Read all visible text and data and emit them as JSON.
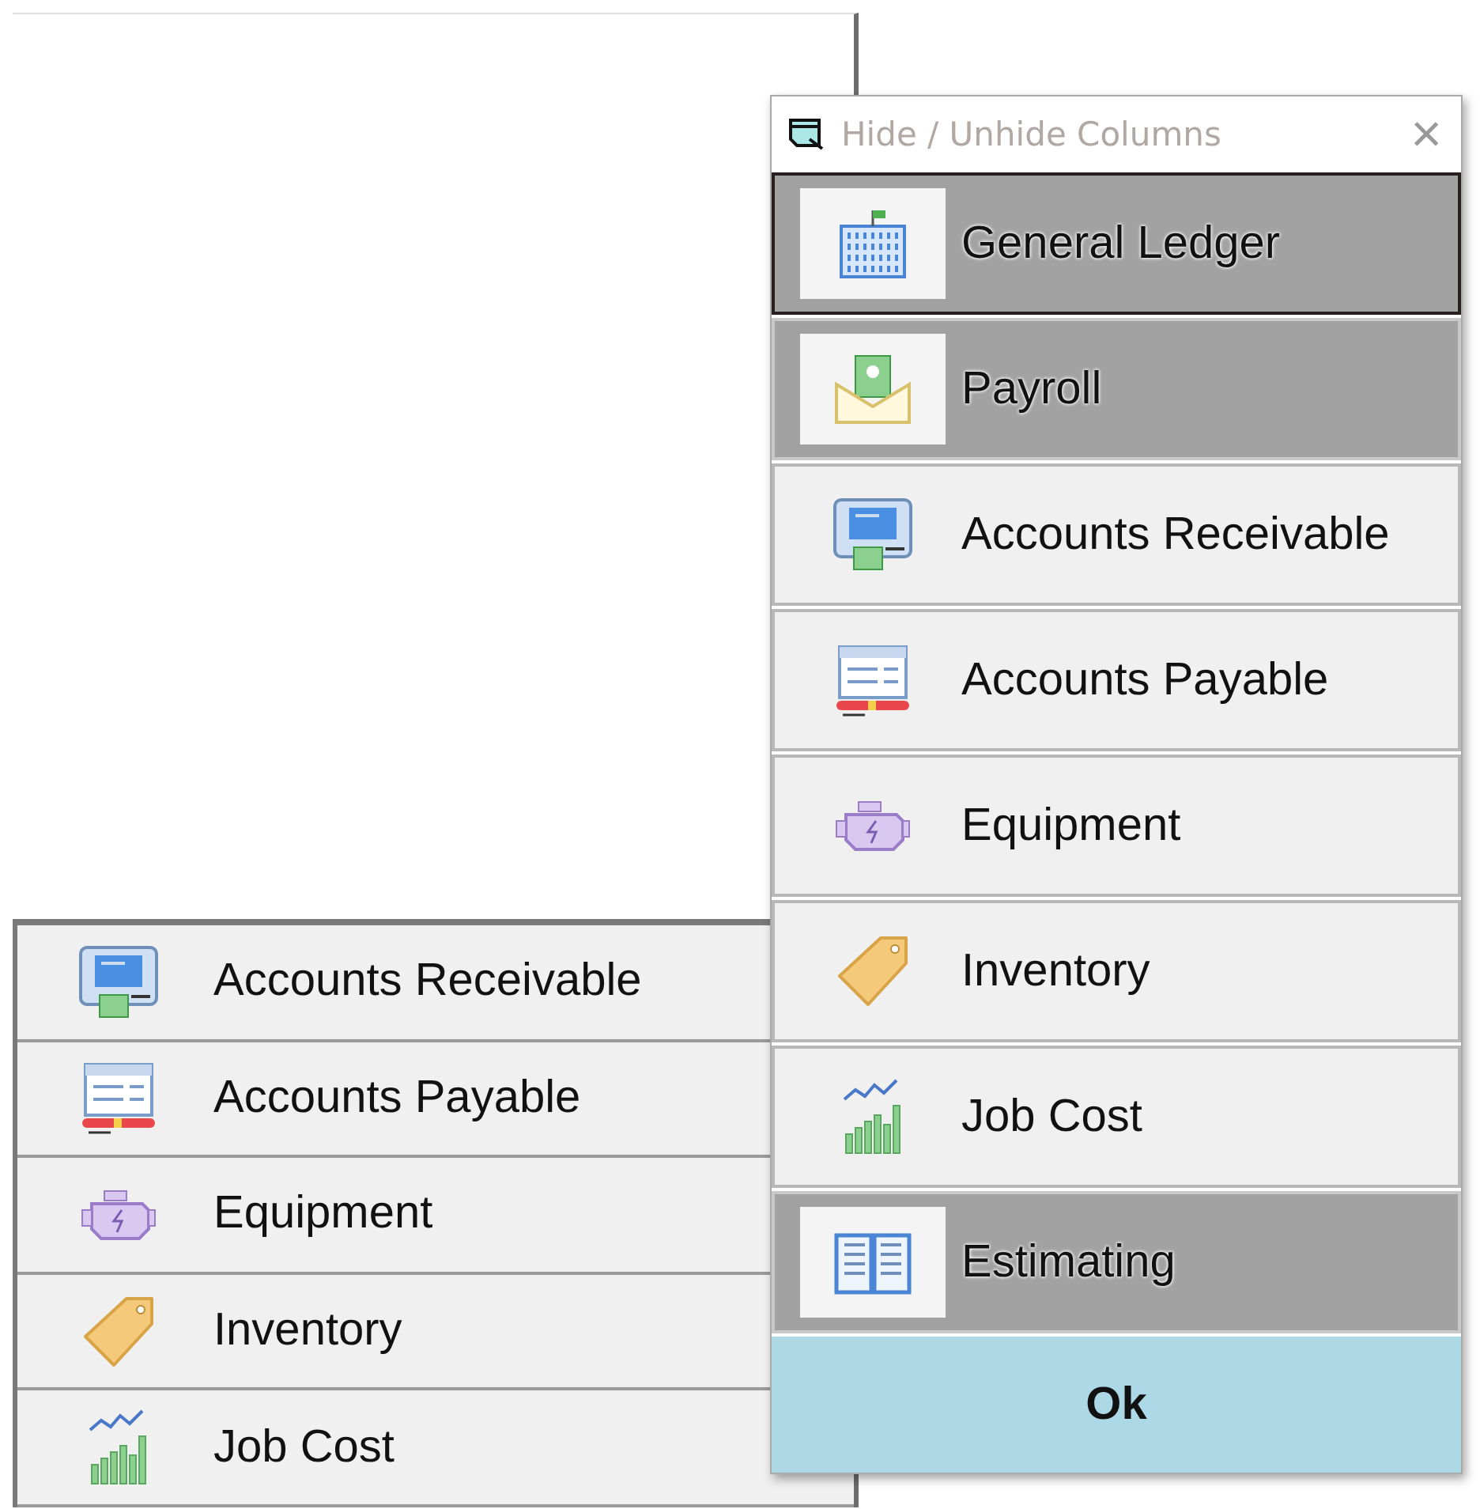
{
  "visible_columns": [
    {
      "label": "Accounts Receivable"
    },
    {
      "label": "Accounts Payable"
    },
    {
      "label": "Equipment"
    },
    {
      "label": "Inventory"
    },
    {
      "label": "Job Cost"
    }
  ],
  "dialog": {
    "title": "Hide / Unhide Columns",
    "close": "×",
    "items": [
      {
        "label": "General Ledger",
        "hidden": true,
        "focused": true
      },
      {
        "label": "Payroll",
        "hidden": true,
        "focused": false
      },
      {
        "label": "Accounts Receivable",
        "hidden": false,
        "focused": false
      },
      {
        "label": "Accounts Payable",
        "hidden": false,
        "focused": false
      },
      {
        "label": "Equipment",
        "hidden": false,
        "focused": false
      },
      {
        "label": "Inventory",
        "hidden": false,
        "focused": false
      },
      {
        "label": "Job Cost",
        "hidden": false,
        "focused": false
      },
      {
        "label": "Estimating",
        "hidden": true,
        "focused": false
      }
    ],
    "ok": "Ok"
  }
}
